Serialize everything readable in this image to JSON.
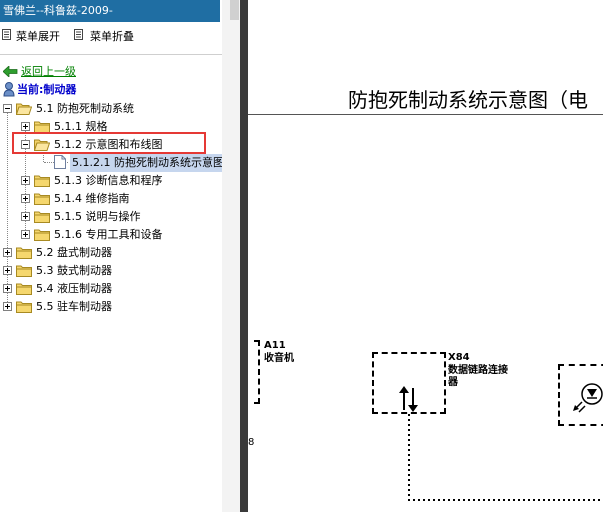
{
  "window": {
    "title": "雪佛兰--科鲁兹-2009-"
  },
  "toolbar": {
    "expand_label": "菜单展开",
    "collapse_label": "菜单折叠"
  },
  "nav": {
    "back_label": "返回上一级",
    "current_label": "当前:制动器"
  },
  "tree": {
    "n5_1": "5.1 防抱死制动系统",
    "n5_1_1": "5.1.1 规格",
    "n5_1_2": "5.1.2 示意图和布线图",
    "n5_1_2_1": "5.1.2.1 防抱死制动系统示意图",
    "n5_1_3": "5.1.3 诊断信息和程序",
    "n5_1_4": "5.1.4 维修指南",
    "n5_1_5": "5.1.5 说明与操作",
    "n5_1_6": "5.1.6 专用工具和设备",
    "n5_2": "5.2 盘式制动器",
    "n5_3": "5.3 鼓式制动器",
    "n5_4": "5.4 液压制动器",
    "n5_5": "5.5 驻车制动器"
  },
  "document": {
    "title": "防抱死制动系统示意图（电",
    "a11_code": "A11",
    "a11_name": "收音机",
    "x84_code": "X84",
    "x84_name_1": "数据链路连接",
    "x84_name_2": "器",
    "edge_char": "8"
  },
  "colors": {
    "title_bar": "#1f6ea3",
    "link_green": "#008000",
    "current_blue": "#0000cc",
    "highlight_box": "#e53935"
  }
}
